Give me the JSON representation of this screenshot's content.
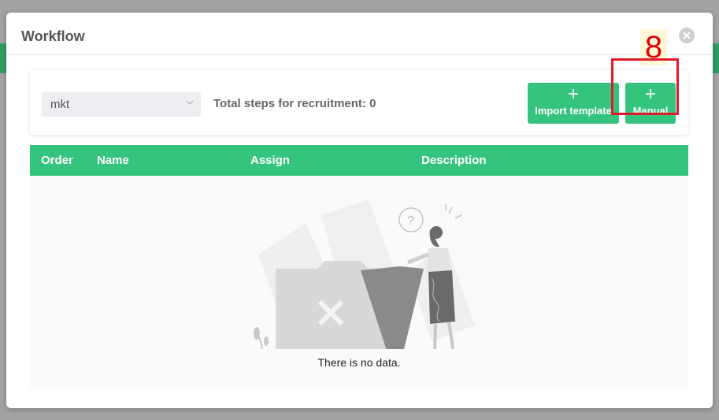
{
  "modal": {
    "title": "Workflow"
  },
  "annotation": {
    "step_number": "8"
  },
  "toolbar": {
    "select_value": "mkt",
    "steps_label": "Total steps for recruitment: 0",
    "import_button_label": "Import template",
    "manual_button_label": "Manual"
  },
  "table": {
    "columns": [
      "Order",
      "Name",
      "Assign",
      "Description"
    ],
    "empty_message": "There is no data."
  },
  "colors": {
    "accent": "#35c47d",
    "highlight": "#e01a2b"
  }
}
